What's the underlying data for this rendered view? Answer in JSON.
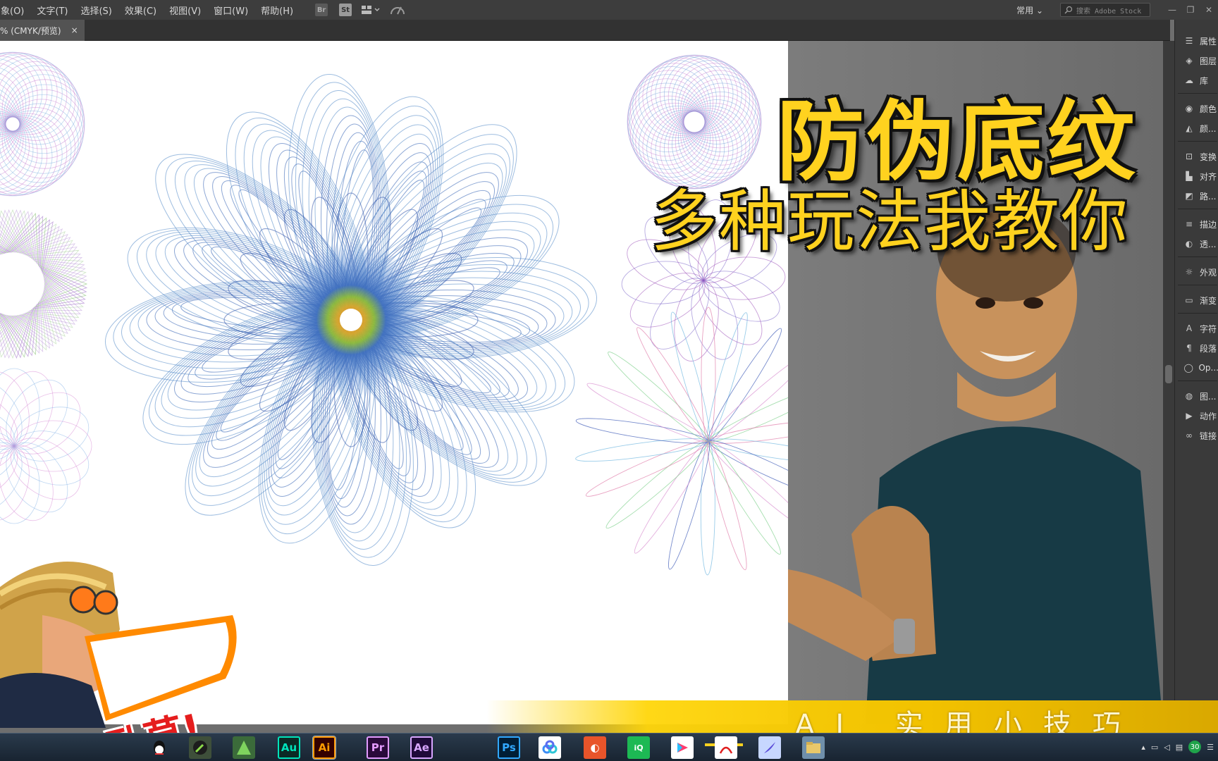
{
  "menu": {
    "items": [
      "象(O)",
      "文字(T)",
      "选择(S)",
      "效果(C)",
      "视图(V)",
      "窗口(W)",
      "帮助(H)"
    ],
    "bridge_badge": "Br",
    "stock_badge": "St"
  },
  "workspace": {
    "label": "常用"
  },
  "search": {
    "placeholder": "搜索 Adobe Stock"
  },
  "document_tab": {
    "title": "% (CMYK/预览)",
    "close": "×"
  },
  "panels": [
    {
      "label": "属性",
      "icon": "properties-icon"
    },
    {
      "label": "图层",
      "icon": "layers-icon"
    },
    {
      "label": "库",
      "icon": "libraries-icon"
    },
    {
      "label": "颜色",
      "icon": "color-icon"
    },
    {
      "label": "颜...",
      "icon": "color-guide-icon"
    },
    {
      "label": "变换",
      "icon": "transform-icon"
    },
    {
      "label": "对齐",
      "icon": "align-icon"
    },
    {
      "label": "路...",
      "icon": "pathfinder-icon"
    },
    {
      "label": "描边",
      "icon": "stroke-icon"
    },
    {
      "label": "透...",
      "icon": "transparency-icon"
    },
    {
      "label": "外观",
      "icon": "appearance-icon"
    },
    {
      "label": "渐变",
      "icon": "gradient-icon"
    },
    {
      "label": "字符",
      "icon": "character-icon"
    },
    {
      "label": "段落",
      "icon": "paragraph-icon"
    },
    {
      "label": "Op...",
      "icon": "opentype-icon"
    },
    {
      "label": "图...",
      "icon": "graphic-styles-icon"
    },
    {
      "label": "动作",
      "icon": "actions-icon"
    },
    {
      "label": "链接",
      "icon": "links-icon"
    }
  ],
  "overlay": {
    "title": "防伪底纹",
    "subtitle": "多种玩法我教你",
    "banner": "AI 实用小技巧",
    "sticker": "卧草!"
  },
  "taskbar": {
    "apps": [
      {
        "label": "Au",
        "name": "audition-app",
        "color": "#00e4bb",
        "bg": "#0b2a25"
      },
      {
        "label": "Ai",
        "name": "illustrator-app",
        "color": "#ff9a00",
        "bg": "#330000"
      },
      {
        "label": "Pr",
        "name": "premiere-app",
        "color": "#e39bff",
        "bg": "#2a0a3b"
      },
      {
        "label": "Ae",
        "name": "after-effects-app",
        "color": "#d8a6ff",
        "bg": "#1f0a3a"
      },
      {
        "label": "Ps",
        "name": "photoshop-app",
        "color": "#31a8ff",
        "bg": "#001e36"
      }
    ],
    "tray_count": "30"
  },
  "colors": {
    "accent_yellow": "#ffd21f",
    "menubar": "#3d3d3d",
    "panel": "#3a3a3a"
  }
}
